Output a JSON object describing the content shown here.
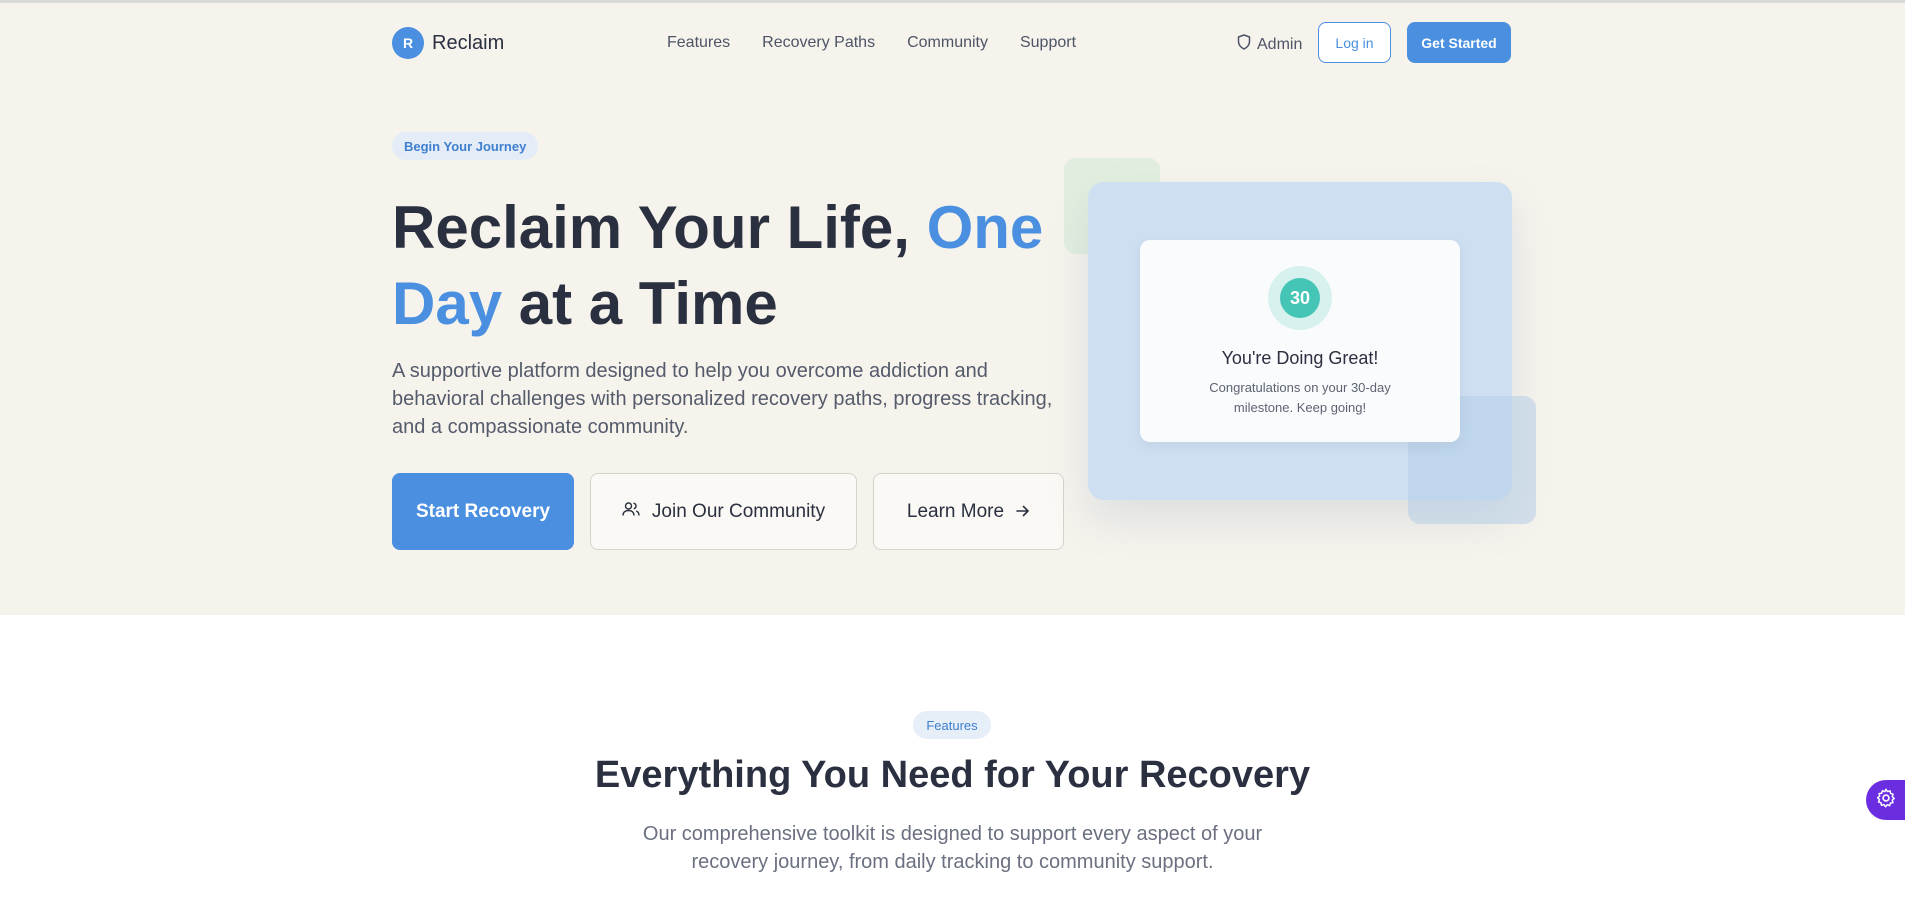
{
  "header": {
    "logo_letter": "R",
    "logo_text": "Reclaim",
    "nav": [
      "Features",
      "Recovery Paths",
      "Community",
      "Support"
    ],
    "admin_label": "Admin",
    "login_label": "Log in",
    "get_started_label": "Get Started"
  },
  "hero": {
    "pill": "Begin Your Journey",
    "headline_part1": "Reclaim Your Life, ",
    "headline_accent": "One Day",
    "headline_part2": " at a Time",
    "subtitle": "A supportive platform designed to help you overcome addiction and behavioral challenges with personalized recovery paths, progress tracking, and a compassionate community.",
    "cta_primary": "Start Recovery",
    "cta_community": "Join Our Community",
    "cta_learn": "Learn More"
  },
  "milestone_card": {
    "days": "30",
    "title": "You're Doing Great!",
    "text": "Congratulations on your 30-day milestone. Keep going!"
  },
  "features": {
    "pill": "Features",
    "title": "Everything You Need for Your Recovery",
    "subtitle": "Our comprehensive toolkit is designed to support every aspect of your recovery journey, from daily tracking to community support."
  },
  "colors": {
    "accent": "#4a8fe0",
    "hero_bg": "#f5f3ec",
    "milestone": "#45c5b6",
    "widget": "#6a2ee0"
  },
  "icons": [
    "shield-icon",
    "users-icon",
    "arrow-right-icon",
    "settings-gear-icon"
  ]
}
